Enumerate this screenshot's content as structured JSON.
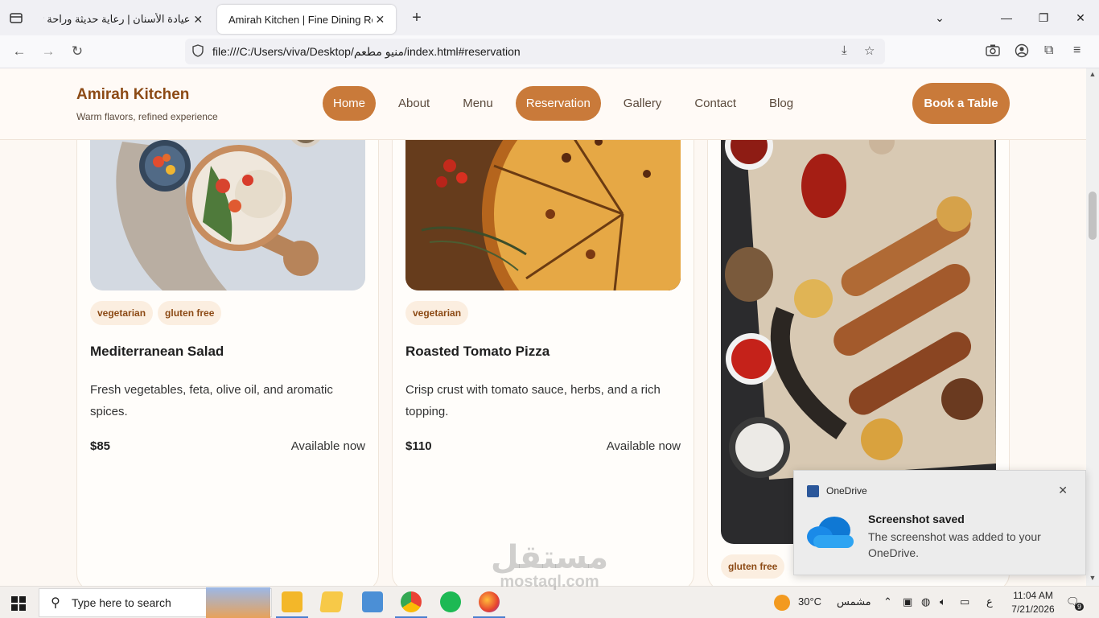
{
  "browser": {
    "tabs": [
      {
        "label": "عيادة الأسنان | رعاية حديثة وراحة تامة",
        "active": false
      },
      {
        "label": "Amirah Kitchen | Fine Dining Restaurant",
        "active": true
      }
    ],
    "url": "file:///C:/Users/viva/Desktop/منيو مطعم/index.html#reservation"
  },
  "site": {
    "brand": "Amirah Kitchen",
    "tagline": "Warm flavors, refined experience",
    "menu": [
      {
        "label": "Home",
        "active": true
      },
      {
        "label": "About",
        "active": false
      },
      {
        "label": "Menu",
        "active": false
      },
      {
        "label": "Reservation",
        "active": true
      },
      {
        "label": "Gallery",
        "active": false
      },
      {
        "label": "Contact",
        "active": false
      },
      {
        "label": "Blog",
        "active": false
      }
    ],
    "cta": "Book a Table",
    "accent": "#c97a3a"
  },
  "dishes": [
    {
      "tags": [
        "vegetarian",
        "gluten free"
      ],
      "title": "Mediterranean Salad",
      "desc": "Fresh vegetables, feta, olive oil, and aromatic spices.",
      "price": "$85",
      "status": "Available now"
    },
    {
      "tags": [
        "vegetarian"
      ],
      "title": "Roasted Tomato Pizza",
      "desc": "Crisp crust with tomato sauce, herbs, and a rich topping.",
      "price": "$110",
      "status": "Available now"
    },
    {
      "tags": [
        "gluten free"
      ]
    }
  ],
  "toast": {
    "app": "OneDrive",
    "title": "Screenshot saved",
    "body": "The screenshot was added to your OneDrive."
  },
  "taskbar": {
    "search_placeholder": "Type here to search",
    "weather_temp": "30°C",
    "weather_label": "مشمس",
    "lang": "ع",
    "time": "11:04 AM",
    "date": "7/21/2026",
    "notif_count": "9"
  },
  "watermark": {
    "ar": "مستقل",
    "lat": "mostaql.com"
  }
}
